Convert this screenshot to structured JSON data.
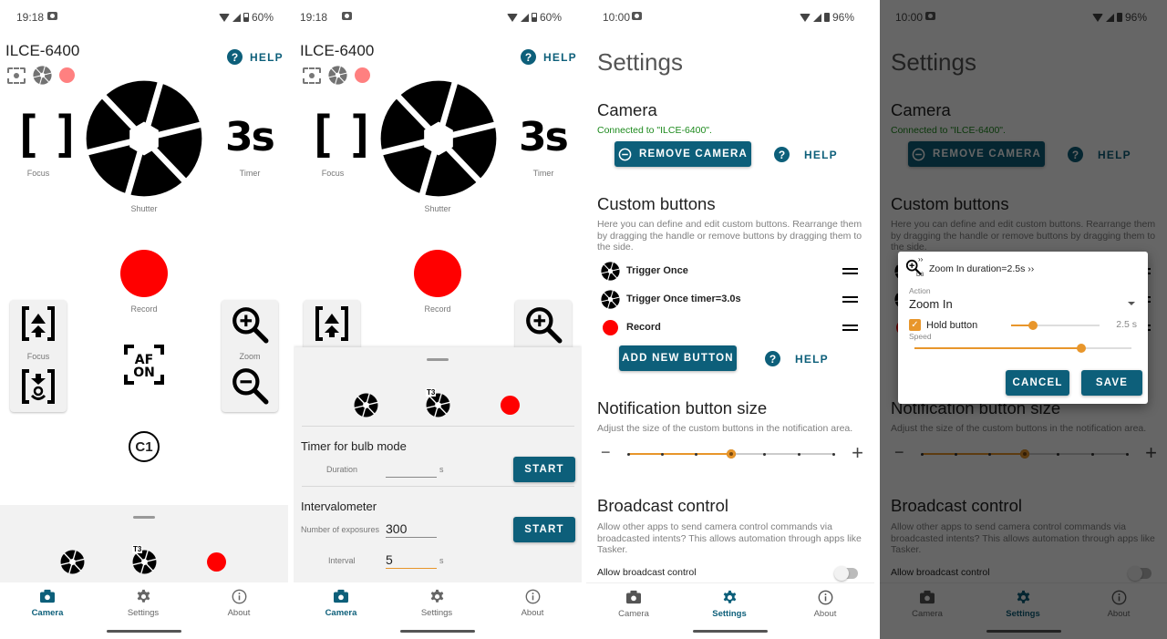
{
  "screens": {
    "camera": {
      "status": {
        "time": "19:18",
        "battery": "60%"
      },
      "camera_name": "ILCE-6400",
      "help_label": "HELP",
      "controls": {
        "focus_label": "Focus",
        "shutter_label": "Shutter",
        "timer_value": "3s",
        "timer_label": "Timer",
        "record_label": "Record",
        "focus_card_label": "Focus",
        "zoom_card_label": "Zoom",
        "af_on_line1": "AF",
        "af_on_line2": "ON",
        "custom_label": "C1"
      },
      "custom_buttons": [
        {
          "icon": "aperture-1x-icon",
          "tag": "1x"
        },
        {
          "icon": "aperture-timer-icon",
          "tag": "1x",
          "timer_tag": "T3"
        },
        {
          "icon": "record-icon"
        }
      ]
    },
    "bulb_panel": {
      "timer_title": "Timer for bulb mode",
      "duration_label": "Duration",
      "duration_value": "",
      "unit_s": "s",
      "start_label": "START",
      "interval_title": "Intervalometer",
      "exposures_label": "Number of exposures",
      "exposures_value": "300",
      "interval_label": "Interval",
      "interval_value": "5"
    },
    "settings": {
      "status": {
        "time": "10:00",
        "battery": "96%"
      },
      "title": "Settings",
      "camera_section": {
        "title": "Camera",
        "connected_text": "Connected to \"ILCE-6400\".",
        "remove_label": "REMOVE CAMERA",
        "help_label": "HELP"
      },
      "custom_section": {
        "title": "Custom buttons",
        "description": "Here you can define and edit custom buttons. Rearrange them by dragging the handle or remove buttons by dragging them to the side.",
        "items": [
          {
            "label": "Trigger Once"
          },
          {
            "label": "Trigger Once timer=3.0s"
          },
          {
            "label": "Record"
          }
        ],
        "add_label": "ADD NEW BUTTON",
        "help_label": "HELP"
      },
      "notification_section": {
        "title": "Notification button size",
        "description": "Adjust the size of the custom buttons in the notification area.",
        "minus": "−",
        "plus": "+",
        "steps": 7,
        "selected_step": 4
      },
      "broadcast_section": {
        "title": "Broadcast control",
        "description": "Allow other apps to send camera control commands via broadcasted intents? This allows automation through apps like Tasker.",
        "toggle_label": "Allow broadcast control",
        "enabled": false
      }
    },
    "dialog": {
      "header": "Zoom In duration=2.5s ››",
      "icon_tag": "D3",
      "action_label": "Action",
      "action_value": "Zoom In",
      "hold_label": "Hold button",
      "hold_checked": true,
      "hold_duration": "2.5 s",
      "hold_fraction": 0.25,
      "speed_label": "Speed",
      "speed_fraction": 0.77,
      "cancel_label": "CANCEL",
      "save_label": "SAVE"
    }
  },
  "nav": {
    "items": [
      {
        "label": "Camera",
        "icon": "camera-icon"
      },
      {
        "label": "Settings",
        "icon": "gear-icon"
      },
      {
        "label": "About",
        "icon": "info-icon"
      }
    ]
  },
  "colors": {
    "primary": "#0d5f7a",
    "accent": "#e8962b",
    "record": "#ff0000",
    "success": "#1d8a1d"
  }
}
